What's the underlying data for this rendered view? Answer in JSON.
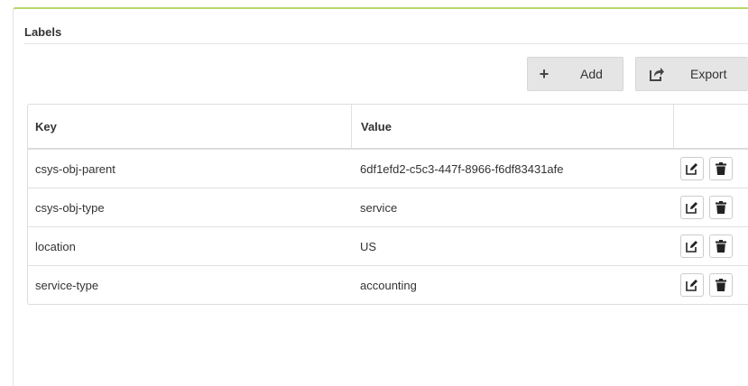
{
  "panel": {
    "title": "Labels",
    "help_icon": "help-circle-icon",
    "help_glyph": "?"
  },
  "toolbar": {
    "add_label": "Add",
    "add_icon": "plus-icon",
    "add_glyph": "+",
    "export_label": "Export",
    "export_icon": "export-icon"
  },
  "table": {
    "columns": {
      "key": "Key",
      "value": "Value"
    },
    "rows": [
      {
        "key": "csys-obj-parent",
        "value": "6df1efd2-c5c3-447f-8966-f6df83431afe"
      },
      {
        "key": "csys-obj-type",
        "value": "service"
      },
      {
        "key": "location",
        "value": "US"
      },
      {
        "key": "service-type",
        "value": "accounting"
      }
    ],
    "row_actions": [
      "edit-icon",
      "trash-icon"
    ]
  },
  "colors": {
    "accent": "#b6d96b",
    "button_bg": "#e5e5e5"
  }
}
